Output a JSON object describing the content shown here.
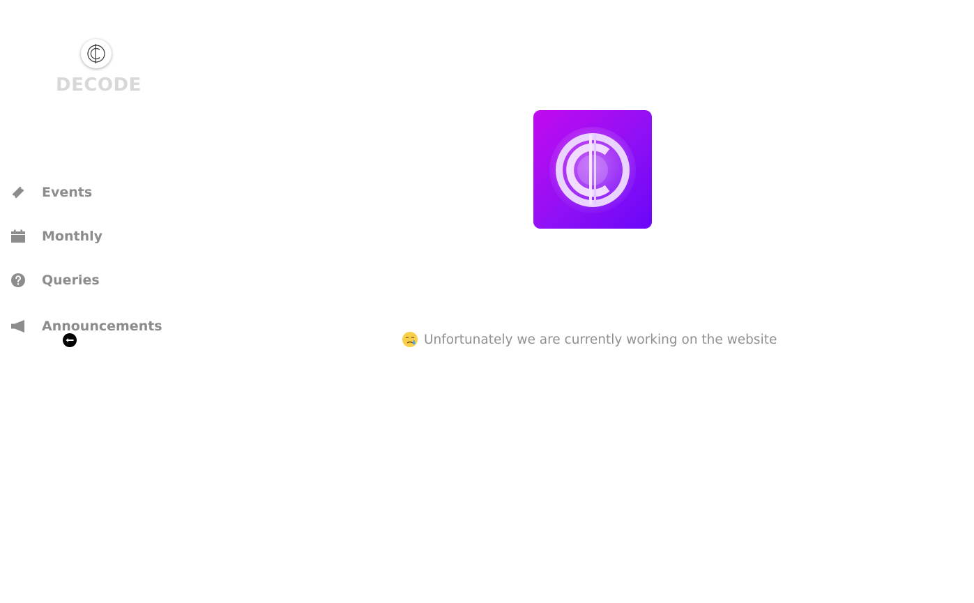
{
  "brand": {
    "name": "DECODE",
    "logo_icon": "c-monogram-icon"
  },
  "sidebar": {
    "items": [
      {
        "label": "Events",
        "icon": "ticket-icon"
      },
      {
        "label": "Monthly",
        "icon": "calendar-icon"
      },
      {
        "label": "Queries",
        "icon": "question-circle-icon"
      },
      {
        "label": "Announcements",
        "icon": "megaphone-icon"
      }
    ],
    "logout_icon": "minus-circle-icon"
  },
  "main": {
    "app_logo_icon": "decode-app-icon",
    "status_emoji": "crying-face-emoji",
    "status_text": "Unfortunately we are currently working on the website"
  },
  "colors": {
    "nav_text": "#8c8c8c",
    "brand_text": "#d8d8d8",
    "logo_gradient_start": "#c20aef",
    "logo_gradient_end": "#6a06f9",
    "status_text": "#909090"
  }
}
